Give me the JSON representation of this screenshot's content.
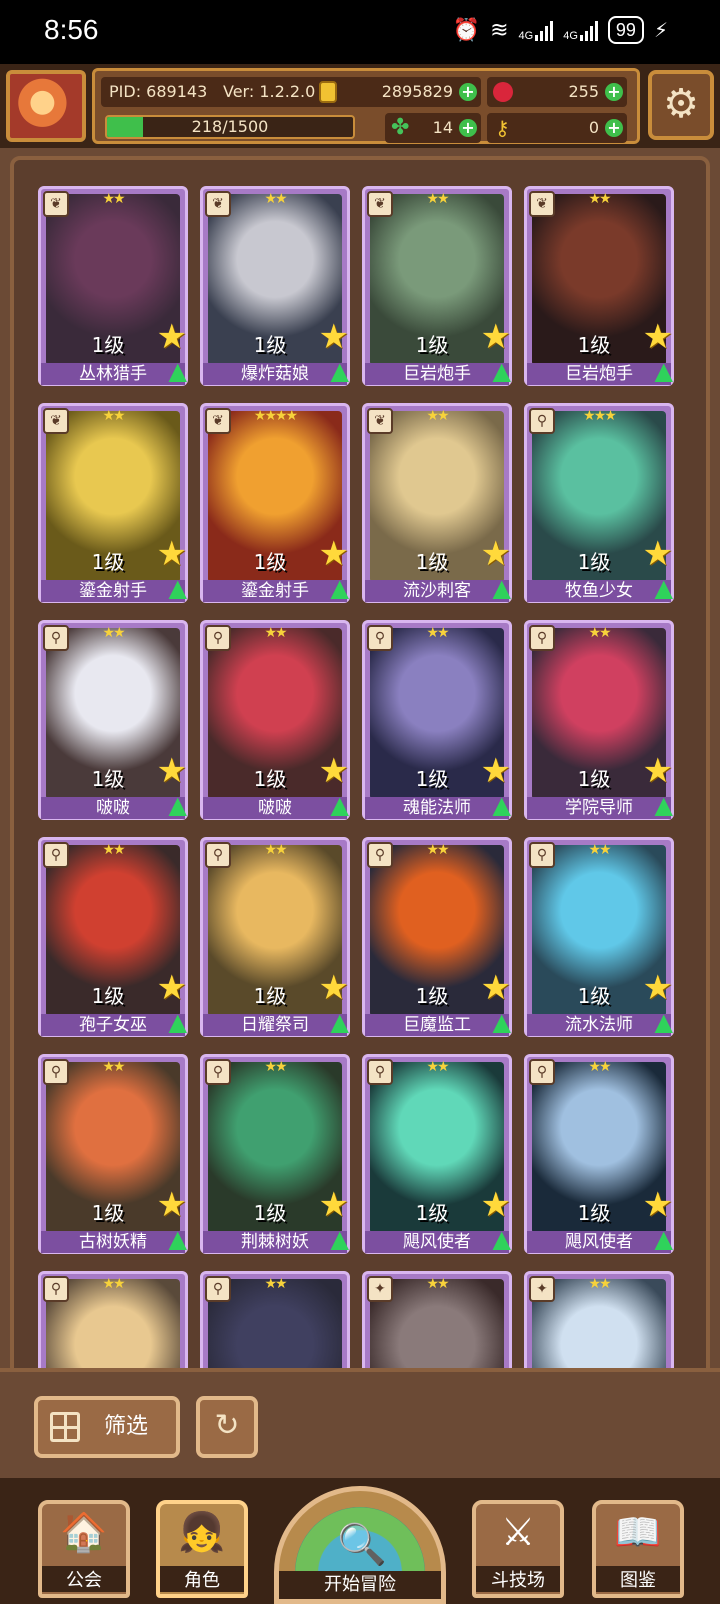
{
  "status_bar": {
    "time": "8:56",
    "network_1": "4G",
    "network_2": "4G",
    "battery": "99"
  },
  "hud": {
    "pid": "PID: 689143",
    "version": "Ver: 1.2.2.0",
    "gold": "2895829",
    "gems": "255",
    "energy": "218/1500",
    "energy_fraction": 0.145,
    "clover": "14",
    "keys": "0"
  },
  "cards": [
    {
      "name": "丛林猎手",
      "level": "1级",
      "stars": "★★",
      "type_icon": "leaf",
      "colors": [
        "#3a2a3a",
        "#6a3a5a"
      ]
    },
    {
      "name": "爆炸菇娘",
      "level": "1级",
      "stars": "★★",
      "type_icon": "leaf",
      "colors": [
        "#3a4050",
        "#c8c8d0"
      ]
    },
    {
      "name": "巨岩炮手",
      "level": "1级",
      "stars": "★★",
      "type_icon": "leaf",
      "colors": [
        "#3a4a3a",
        "#7a9a7a"
      ]
    },
    {
      "name": "巨岩炮手",
      "level": "1级",
      "stars": "★★",
      "type_icon": "leaf",
      "colors": [
        "#2a1a1a",
        "#7a3a2a"
      ]
    },
    {
      "name": "鎏金射手",
      "level": "1级",
      "stars": "★★",
      "type_icon": "leaf",
      "colors": [
        "#6a5a1a",
        "#e8c850"
      ]
    },
    {
      "name": "鎏金射手",
      "level": "1级",
      "stars": "★★★★",
      "type_icon": "leaf",
      "colors": [
        "#8a2a1a",
        "#f0a030"
      ]
    },
    {
      "name": "流沙刺客",
      "level": "1级",
      "stars": "★★",
      "type_icon": "leaf",
      "colors": [
        "#7a6a4a",
        "#e0c890"
      ]
    },
    {
      "name": "牧鱼少女",
      "level": "1级",
      "stars": "★★★",
      "type_icon": "key",
      "colors": [
        "#2a4a4a",
        "#5ac0a0"
      ]
    },
    {
      "name": "啵啵",
      "level": "1级",
      "stars": "★★",
      "type_icon": "key",
      "colors": [
        "#4a3a3a",
        "#e8e8f0"
      ]
    },
    {
      "name": "啵啵",
      "level": "1级",
      "stars": "★★",
      "type_icon": "key",
      "colors": [
        "#4a2a2a",
        "#d04050"
      ]
    },
    {
      "name": "魂能法师",
      "level": "1级",
      "stars": "★★",
      "type_icon": "key",
      "colors": [
        "#2a2a4a",
        "#8a80c0"
      ]
    },
    {
      "name": "学院导师",
      "level": "1级",
      "stars": "★★",
      "type_icon": "key",
      "colors": [
        "#3a2a3a",
        "#d04060"
      ]
    },
    {
      "name": "孢子女巫",
      "level": "1级",
      "stars": "★★",
      "type_icon": "key",
      "colors": [
        "#3a2a2a",
        "#d04030"
      ]
    },
    {
      "name": "日耀祭司",
      "level": "1级",
      "stars": "★★",
      "type_icon": "key",
      "colors": [
        "#5a4a2a",
        "#e8b860"
      ]
    },
    {
      "name": "巨魔监工",
      "level": "1级",
      "stars": "★★",
      "type_icon": "key",
      "colors": [
        "#2a2a3a",
        "#e06020"
      ]
    },
    {
      "name": "流水法师",
      "level": "1级",
      "stars": "★★",
      "type_icon": "key",
      "colors": [
        "#2a4a5a",
        "#60c8e8"
      ]
    },
    {
      "name": "古树妖精",
      "level": "1级",
      "stars": "★★",
      "type_icon": "key",
      "colors": [
        "#4a3a2a",
        "#e07040"
      ]
    },
    {
      "name": "荆棘树妖",
      "level": "1级",
      "stars": "★★",
      "type_icon": "key",
      "colors": [
        "#2a3a2a",
        "#40a070"
      ]
    },
    {
      "name": "飓风使者",
      "level": "1级",
      "stars": "★★",
      "type_icon": "key",
      "colors": [
        "#1a3a3a",
        "#60d8b8"
      ]
    },
    {
      "name": "飓风使者",
      "level": "1级",
      "stars": "★★",
      "type_icon": "key",
      "colors": [
        "#1a2a3a",
        "#a0c0e0"
      ]
    },
    {
      "name": "",
      "level": "",
      "stars": "★★",
      "type_icon": "key",
      "colors": [
        "#5a4a3a",
        "#e8c890"
      ]
    },
    {
      "name": "",
      "level": "",
      "stars": "★★",
      "type_icon": "key",
      "colors": [
        "#2a2a3a",
        "#404060"
      ]
    },
    {
      "name": "",
      "level": "",
      "stars": "★★",
      "type_icon": "shield",
      "colors": [
        "#3a2a2a",
        "#8a7a7a"
      ]
    },
    {
      "name": "",
      "level": "",
      "stars": "★★",
      "type_icon": "shield",
      "colors": [
        "#3a4a5a",
        "#d0e0f0"
      ]
    }
  ],
  "controls": {
    "filter_label": "筛选"
  },
  "nav": {
    "guild": "公会",
    "character": "角色",
    "start_adventure": "开始冒险",
    "arena": "斗技场",
    "catalog": "图鉴"
  }
}
